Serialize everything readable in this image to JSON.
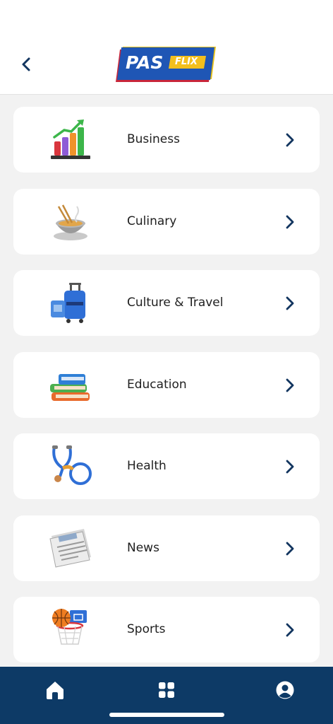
{
  "header": {
    "back_icon": "chevron-left-icon",
    "logo": {
      "primary": "PAS",
      "secondary": "FLIX"
    }
  },
  "categories": [
    {
      "label": "Business",
      "icon": "bar-chart-icon"
    },
    {
      "label": "Culinary",
      "icon": "noodle-bowl-icon"
    },
    {
      "label": "Culture & Travel",
      "icon": "luggage-icon"
    },
    {
      "label": "Education",
      "icon": "books-icon"
    },
    {
      "label": "Health",
      "icon": "stethoscope-icon"
    },
    {
      "label": "News",
      "icon": "newspaper-icon"
    },
    {
      "label": "Sports",
      "icon": "basketball-hoop-icon"
    }
  ],
  "bottom_nav": {
    "items": [
      {
        "icon": "home-icon"
      },
      {
        "icon": "grid-icon"
      },
      {
        "icon": "profile-icon"
      }
    ]
  },
  "colors": {
    "nav_background": "#0d3a66",
    "chevron": "#12355f",
    "background": "#f2f2f2"
  }
}
